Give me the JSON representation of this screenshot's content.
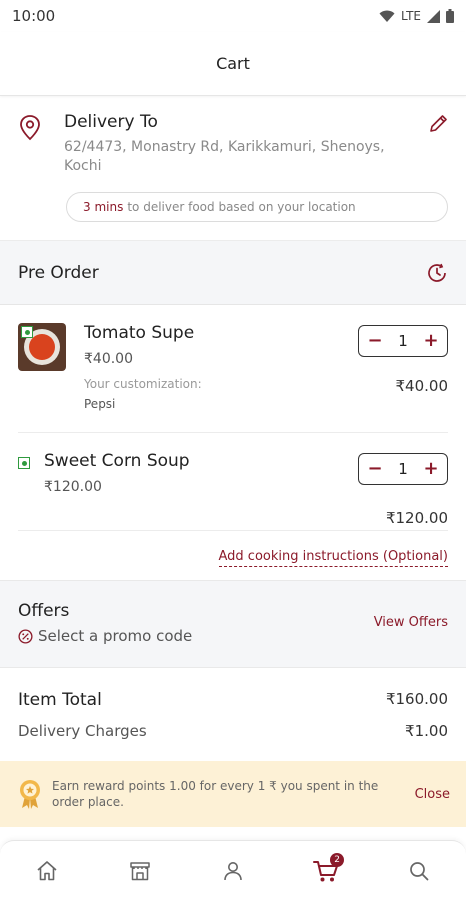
{
  "status_bar": {
    "time": "10:00",
    "network": "LTE"
  },
  "header": {
    "title": "Cart"
  },
  "delivery": {
    "title": "Delivery To",
    "address": "62/4473, Monastry Rd, Karikkamuri, Shenoys, Kochi",
    "eta_strong": "3 mins",
    "eta_text": "to deliver food based on your location"
  },
  "preorder": {
    "title": "Pre Order"
  },
  "items": [
    {
      "name": "Tomato Supe",
      "price": "₹40.00",
      "customization_label": "Your customization:",
      "customization_value": "Pepsi",
      "quantity": "1",
      "line_total": "₹40.00",
      "minus": "−",
      "plus": "+"
    },
    {
      "name": "Sweet Corn Soup",
      "price": "₹120.00",
      "quantity": "1",
      "line_total": "₹120.00",
      "minus": "−",
      "plus": "+"
    }
  ],
  "cooking_instructions": "Add cooking instructions (Optional)",
  "offers": {
    "title": "Offers",
    "promo_text": "Select a promo code",
    "view_offers": "View Offers"
  },
  "totals": {
    "item_total_label": "Item Total",
    "item_total_value": "₹160.00",
    "delivery_label": "Delivery Charges",
    "delivery_value": "₹1.00"
  },
  "reward": {
    "text": "Earn reward points 1.00 for every 1 ₹ you spent in the order place.",
    "close": "Close"
  },
  "bottom_nav": {
    "cart_count": "2",
    "active": "cart"
  },
  "colors": {
    "accent": "#8b1a2a",
    "veg": "#2f9a3e",
    "banner": "#fdf1d6"
  },
  "icons": [
    "location-pin-icon",
    "edit-pencil-icon",
    "clock-icon",
    "promo-icon",
    "award-icon",
    "home-icon",
    "store-icon",
    "profile-icon",
    "cart-icon",
    "search-icon"
  ]
}
